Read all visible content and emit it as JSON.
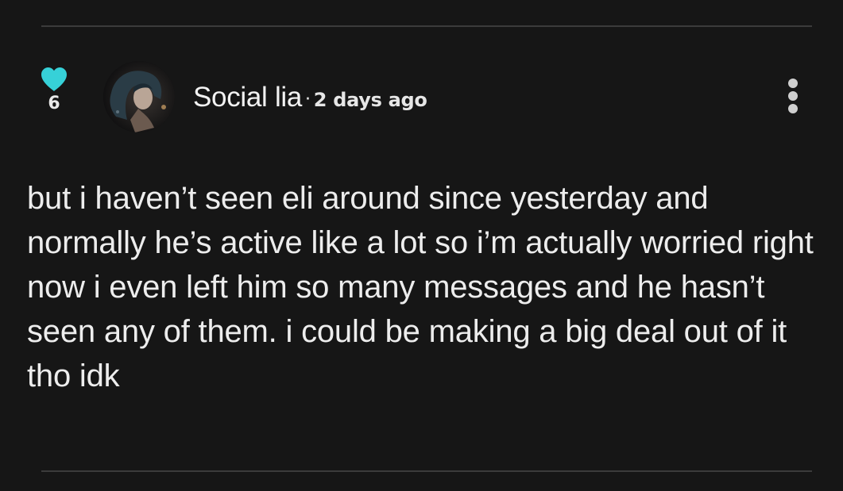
{
  "comment": {
    "likes": {
      "icon": "heart-icon",
      "count": "6",
      "color": "#36d1d8"
    },
    "author": {
      "name": "Social lia",
      "avatar": "avatar-image",
      "separator": "·",
      "timestamp": "2 days ago"
    },
    "more_icon": "more-options-icon",
    "body": "but i haven’t seen eli around since yesterday and normally he’s active like a lot so i’m actually worried right now i even left him so many messages and he hasn’t seen any of them. i could be making a big deal out of it tho idk"
  },
  "colors": {
    "background": "#161616",
    "text": "#ededed",
    "divider": "#3b3b3b",
    "accent": "#36d1d8"
  }
}
